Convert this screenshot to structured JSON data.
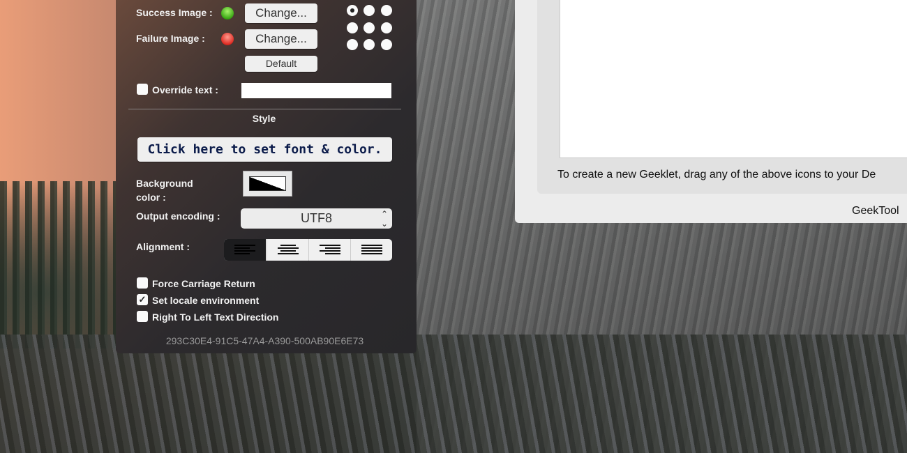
{
  "panel": {
    "success_label": "Success Image :",
    "failure_label": "Failure Image :",
    "change_label": "Change...",
    "default_label": "Default",
    "override_label": "Override text :",
    "override_value": "",
    "override_checked": false,
    "style_heading": "Style",
    "font_button": "Click here to set font & color.",
    "bg_label_1": "Background",
    "bg_label_2": "color :",
    "encoding_label": "Output encoding :",
    "encoding_value": "UTF8",
    "alignment_label": "Alignment :",
    "alignment_options": [
      "left",
      "center",
      "right",
      "justify"
    ],
    "alignment_selected": "left",
    "position_selected": "top-left",
    "checkboxes": [
      {
        "label": "Force Carriage Return",
        "checked": false
      },
      {
        "label": "Set locale environment",
        "checked": true
      },
      {
        "label": "Right To Left Text Direction",
        "checked": false
      }
    ],
    "uuid": "293C30E4-91C5-47A4-A390-500AB90E6E73",
    "colors": {
      "success": "#4cc21a",
      "failure": "#e0322c",
      "font_text": "#0b1b4a"
    }
  },
  "window": {
    "hint": "To create a new Geeklet, drag any of the above icons to your De",
    "footer": "GeekTool"
  }
}
